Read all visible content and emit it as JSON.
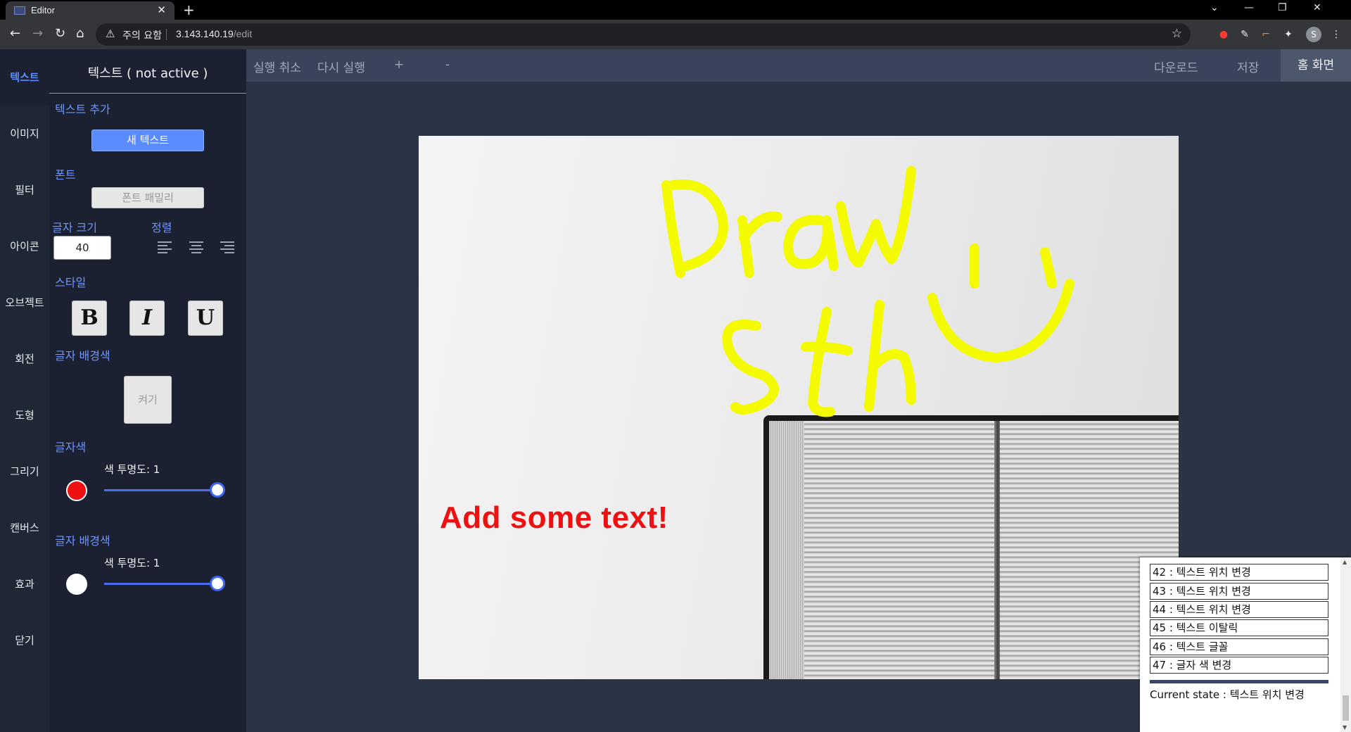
{
  "browser": {
    "tab_title": "Editor",
    "tab_close": "✕",
    "new_tab": "+",
    "security_label": "주의 요함",
    "url_host": "3.143.140.19",
    "url_path": "/edit",
    "profile_initial": "S"
  },
  "sidebar": {
    "items": [
      {
        "label": "텍스트"
      },
      {
        "label": "이미지"
      },
      {
        "label": "필터"
      },
      {
        "label": "아이콘"
      },
      {
        "label": "오브젝트"
      },
      {
        "label": "회전"
      },
      {
        "label": "도형"
      },
      {
        "label": "그리기"
      },
      {
        "label": "캔버스"
      },
      {
        "label": "효과"
      },
      {
        "label": "닫기"
      }
    ],
    "active_index": 0
  },
  "panel": {
    "title": "텍스트 ( not active )",
    "add_text_label": "텍스트 추가",
    "new_text_button": "새 텍스트",
    "font_label": "폰트",
    "font_family_button": "폰트 패밀리",
    "font_size_label": "글자 크기",
    "font_size_value": "40",
    "align_label": "정렬",
    "style_label": "스타일",
    "bold": "B",
    "italic": "I",
    "underline": "U",
    "bg_color_label": "글자 배경색",
    "toggle_button": "켜기",
    "text_color_label": "글자색",
    "text_opacity_label": "색 투명도: 1",
    "text_color": "#ee1111",
    "text_opacity": 1,
    "bg_color_label2": "글자 배경색",
    "bg_opacity_label": "색 투명도: 1",
    "bg_color": "#ffffff",
    "bg_opacity": 1
  },
  "toolbar": {
    "undo": "실행 취소",
    "redo": "다시 실행",
    "zoom_in": "+",
    "zoom_out": "-",
    "download": "다운로드",
    "save": "저장",
    "home": "홈 화면"
  },
  "canvas": {
    "overlay_text": "Add some text!",
    "drawn_text": "Draw Sth"
  },
  "history": {
    "items": [
      "42 : 텍스트 위치 변경",
      "43 : 텍스트 위치 변경",
      "44 : 텍스트 위치 변경",
      "45 : 텍스트 이탈릭",
      "46 : 텍스트 글꼴",
      "47 : 글자 색 변경"
    ],
    "current_state": "Current state : 텍스트 위치 변경"
  }
}
